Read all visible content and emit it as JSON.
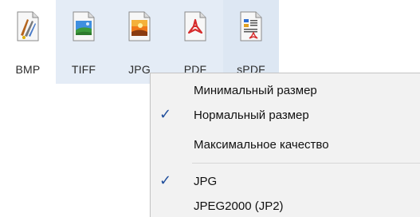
{
  "file_types": [
    {
      "label": "BMP",
      "icon": "bmp-file-icon"
    },
    {
      "label": "TIFF",
      "icon": "tiff-file-icon"
    },
    {
      "label": "JPG",
      "icon": "jpg-file-icon"
    },
    {
      "label": "PDF",
      "icon": "pdf-file-icon"
    },
    {
      "label": "sPDF",
      "icon": "spdf-file-icon"
    }
  ],
  "context_menu": {
    "size_options": [
      {
        "label": "Минимальный размер",
        "checked": false
      },
      {
        "label": "Нормальный размер",
        "checked": true
      },
      {
        "label": "Максимальное качество",
        "checked": false
      }
    ],
    "format_options": [
      {
        "label": "JPG",
        "checked": true
      },
      {
        "label": "JPEG2000 (JP2)",
        "checked": false
      }
    ],
    "check_mark": "✓"
  },
  "colors": {
    "selected_tile": "#e4ecf6",
    "menu_background": "#f2f2f2",
    "check_color": "#1f4e9c",
    "pdf_red": "#d62b2b"
  }
}
